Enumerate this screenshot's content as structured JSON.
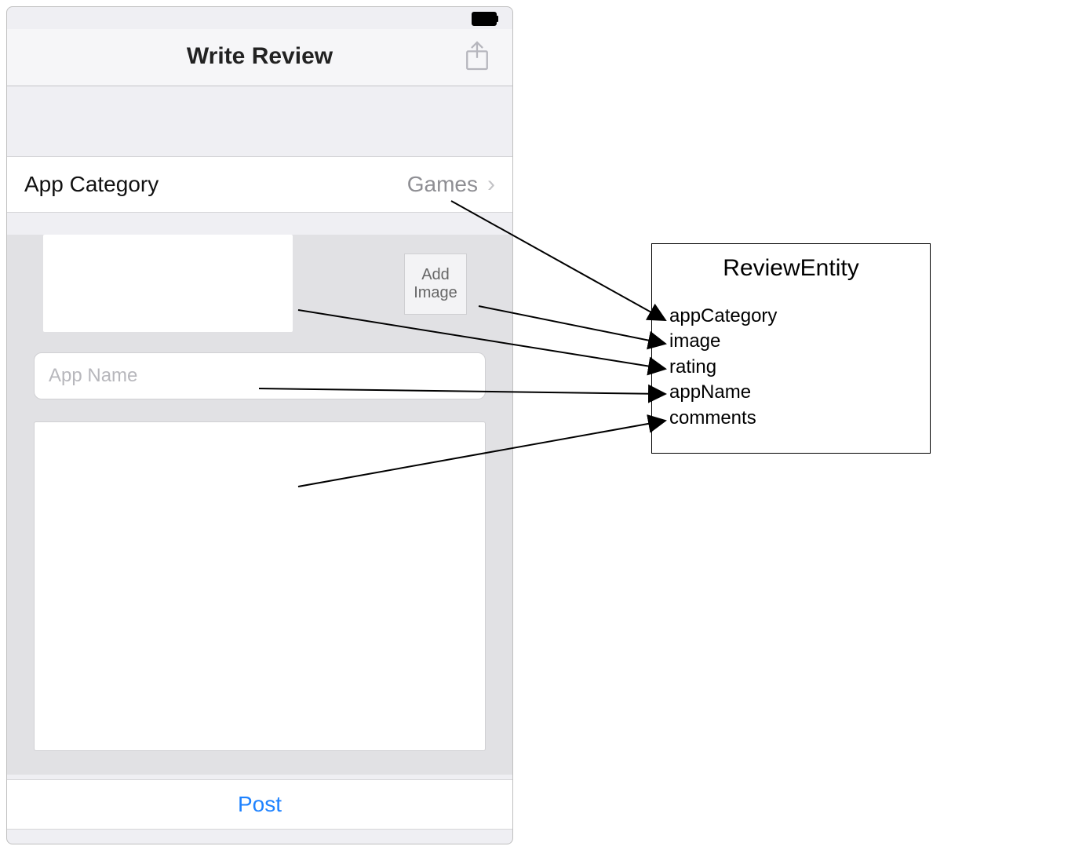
{
  "phone": {
    "nav_title": "Write Review",
    "category_row": {
      "label": "App Category",
      "value": "Games"
    },
    "add_image_label": "Add\nImage",
    "app_name_placeholder": "App Name",
    "post_label": "Post"
  },
  "entity": {
    "title": "ReviewEntity",
    "attributes": [
      "appCategory",
      "image",
      "rating",
      "appName",
      "comments"
    ]
  },
  "arrows": [
    {
      "from": "category-value",
      "to": "appCategory"
    },
    {
      "from": "add-image-button",
      "to": "image"
    },
    {
      "from": "app-name-input",
      "to": "appName"
    },
    {
      "from": "comments-textarea",
      "to": "comments"
    }
  ]
}
